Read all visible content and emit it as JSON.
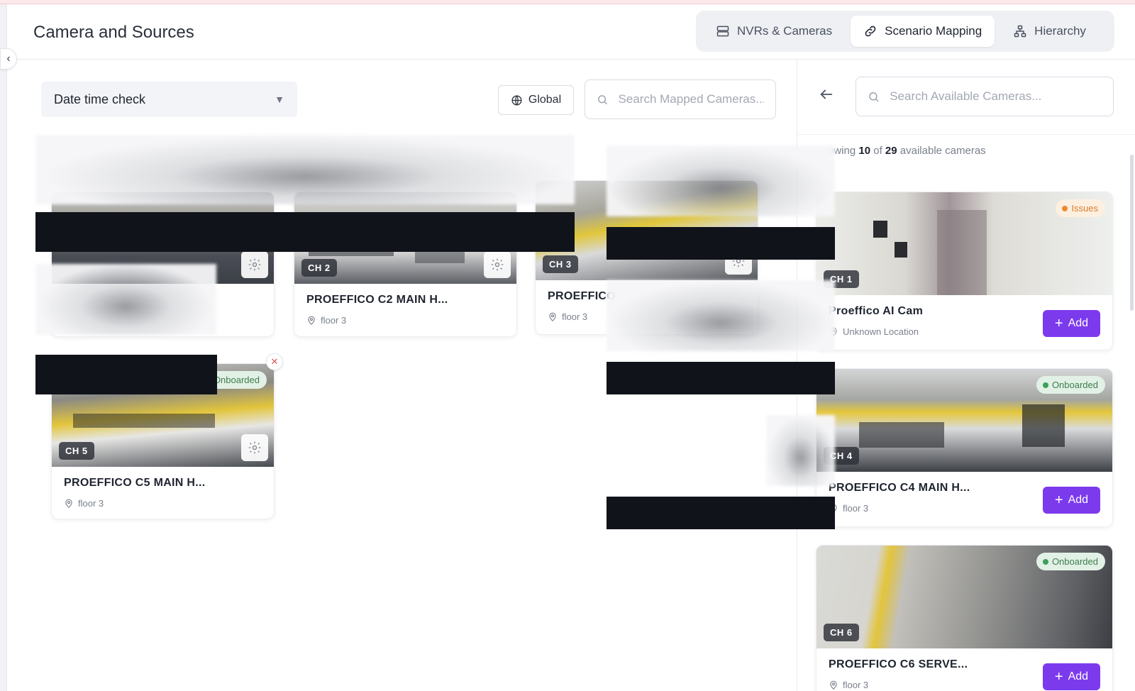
{
  "header": {
    "title": "Camera and Sources",
    "tabs": [
      {
        "label": "NVRs & Cameras",
        "icon": "server-icon",
        "active": false
      },
      {
        "label": "Scenario Mapping",
        "icon": "link-icon",
        "active": true
      },
      {
        "label": "Hierarchy",
        "icon": "hierarchy-icon",
        "active": false
      }
    ]
  },
  "mapped": {
    "scenario_selected": "Date time check",
    "global_label": "Global",
    "search_placeholder": "Search Mapped Cameras...",
    "cards": [
      {
        "channel": "CH 2",
        "name": "PROEFFICO C2 MAIN H...",
        "location": "floor 3"
      },
      {
        "channel": "CH 3",
        "name": "PROEFFICO",
        "location": "floor 3"
      },
      {
        "channel": "CH 5",
        "name": "PROEFFICO C5 MAIN H...",
        "location": "floor 3",
        "status": "Onboarded"
      }
    ]
  },
  "available": {
    "search_placeholder": "Search Available Cameras...",
    "showing_prefix": "owing",
    "showing_count": "10",
    "showing_of": "of",
    "showing_total": "29",
    "showing_suffix": "available cameras",
    "add_label": "Add",
    "cards": [
      {
        "channel": "CH 1",
        "name": "Proeffico AI Cam",
        "location": "Unknown Location",
        "status": "Issues"
      },
      {
        "channel": "CH 4",
        "name": "PROEFFICO C4 MAIN H...",
        "location": "floor 3",
        "status": "Onboarded"
      },
      {
        "channel": "CH 6",
        "name": "PROEFFICO C6 SERVE...",
        "location": "floor 3",
        "status": "Onboarded"
      }
    ]
  },
  "colors": {
    "accent": "#7c3aed",
    "onboarded": "#3aa05a",
    "issues": "#ee8a2e"
  }
}
